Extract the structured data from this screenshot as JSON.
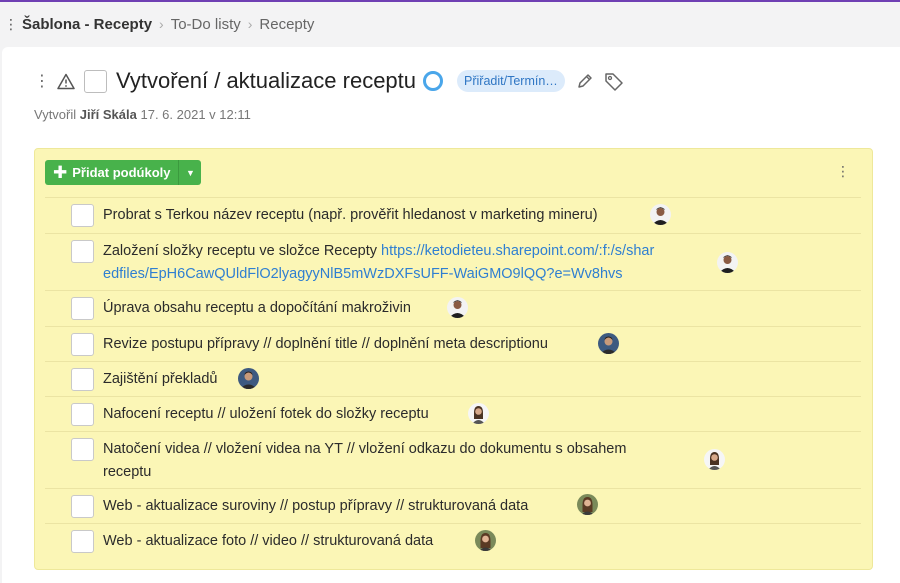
{
  "breadcrumb": {
    "root": "Šablona - Recepty",
    "items": [
      "To-Do listy",
      "Recepty"
    ]
  },
  "task": {
    "title": "Vytvoření / aktualizace receptu",
    "assign_label": "Přiřadit/Termín…",
    "created_prefix": "Vytvořil",
    "author": "Jiří Skála",
    "created_at": "17. 6. 2021 v 12:11"
  },
  "subtasks": {
    "add_label": "Přidat podúkoly",
    "items": [
      {
        "text": "Probrat s Terkou název receptu (např. prověřit hledanost v marketing mineru)",
        "avatar": "man-dark-shirt"
      },
      {
        "text_1": "Založení složky receptu ve složce Recepty ",
        "link_1": "https://ketodieteu.sharepoint.com/:f:/s/shar",
        "link_2": "edfiles/EpH6CawQUldFlO2lyagyyNlB5mWzDXFsUFF-WaiGMO9lQQ?e=Wv8hvs",
        "avatar": "man-dark-shirt"
      },
      {
        "text": "Úprava obsahu receptu a dopočítání makroživin",
        "avatar": "man-dark-shirt"
      },
      {
        "text": "Revize postupu přípravy // doplnění title // doplnění meta descriptionu",
        "avatar": "man-blue-bg"
      },
      {
        "text": "Zajištění překladů",
        "avatar": "man-blue-bg"
      },
      {
        "text": "Nafocení receptu // uložení fotek do složky receptu",
        "avatar": "woman-white-bg"
      },
      {
        "text_1": "Natočení videa // vložení videa na YT // vložení odkazu do dokumentu s obsahem",
        "text_2": "receptu",
        "avatar": "woman-white-bg"
      },
      {
        "text": "Web - aktualizace suroviny // postup přípravy // strukturovaná data",
        "avatar": "woman-green-bg"
      },
      {
        "text": "Web - aktualizace foto // video // strukturovaná data",
        "avatar": "woman-green-bg"
      }
    ]
  },
  "colors": {
    "accent": "#6f3fb3",
    "panel": "#fbf6b6",
    "add_button": "#48b24b",
    "link": "#2f7fd1",
    "status_ring": "#4aa6ea"
  }
}
